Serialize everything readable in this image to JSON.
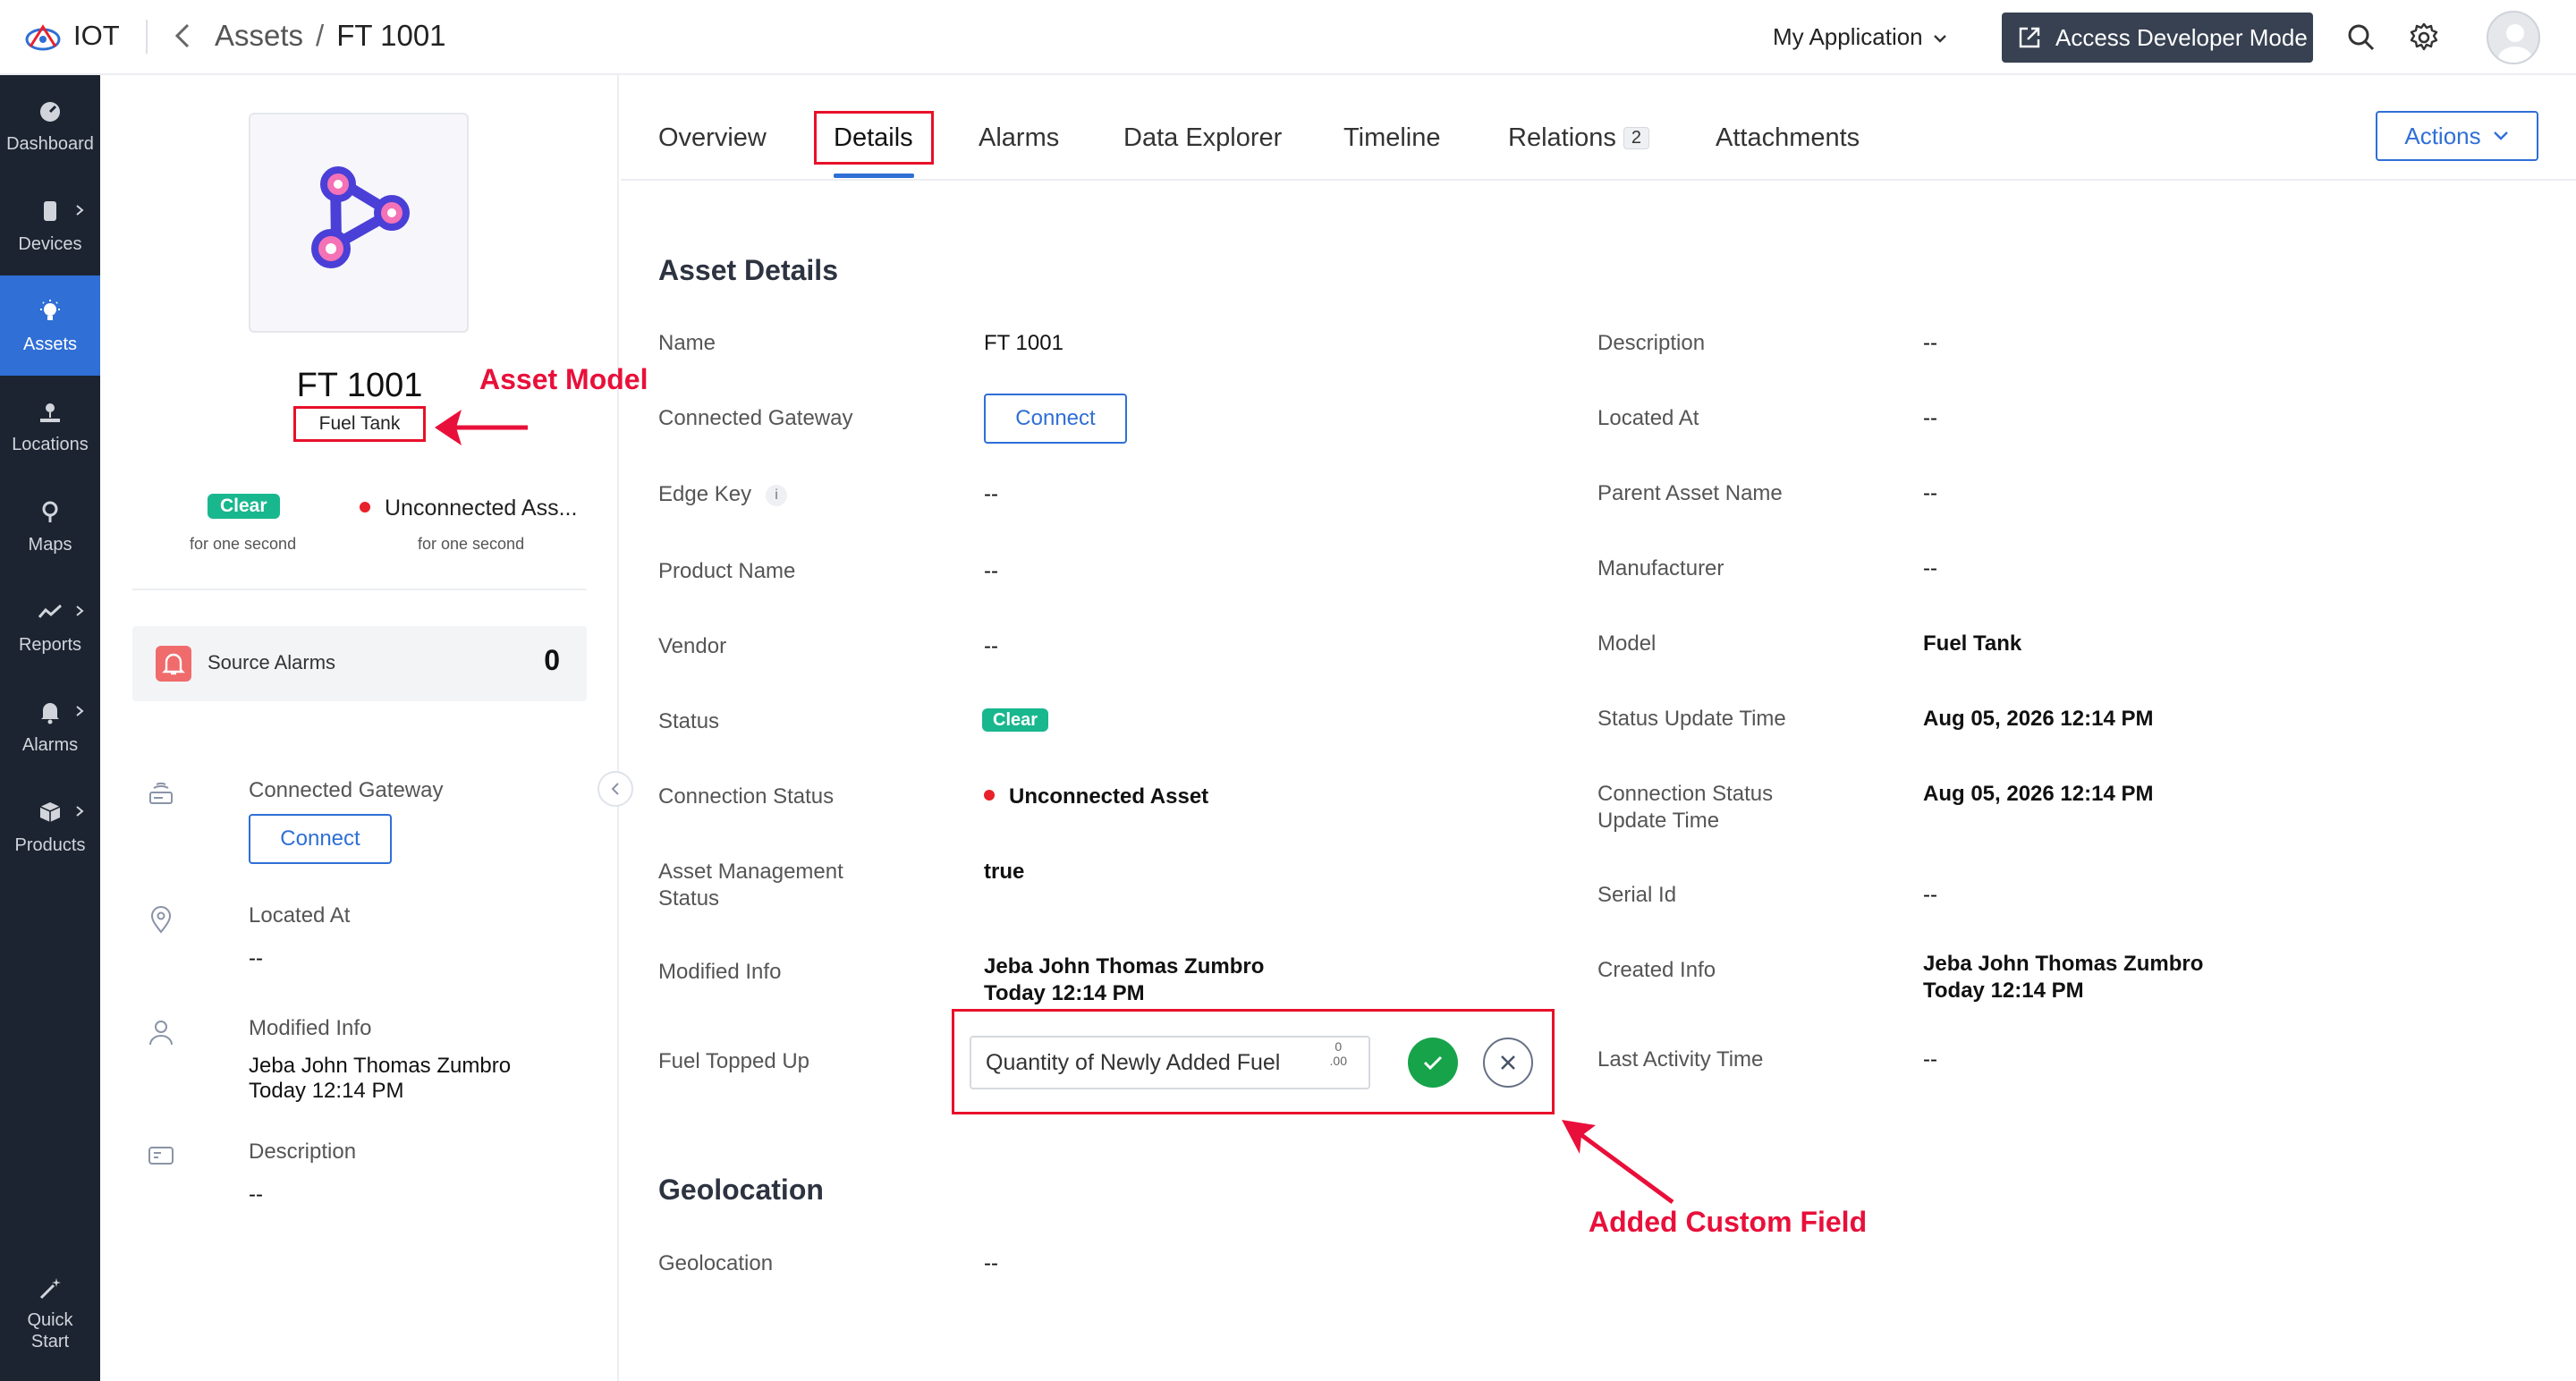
{
  "header": {
    "brand": "IOT",
    "breadcrumb": {
      "parent": "Assets",
      "separator": "/",
      "current": "FT 1001"
    },
    "app_selector": "My Application",
    "developer_button": "Access Developer Mode"
  },
  "sidebar": {
    "items": [
      {
        "label": "Dashboard",
        "icon": "dashboard-icon",
        "active": false
      },
      {
        "label": "Devices",
        "icon": "devices-icon",
        "active": false
      },
      {
        "label": "Assets",
        "icon": "assets-icon",
        "active": true
      },
      {
        "label": "Locations",
        "icon": "locations-icon",
        "active": false
      },
      {
        "label": "Maps",
        "icon": "maps-icon",
        "active": false
      },
      {
        "label": "Reports",
        "icon": "reports-icon",
        "active": false
      },
      {
        "label": "Alarms",
        "icon": "alarms-icon",
        "active": false
      },
      {
        "label": "Products",
        "icon": "products-icon",
        "active": false
      }
    ],
    "quick_start": {
      "line1": "Quick",
      "line2": "Start"
    }
  },
  "asset": {
    "name": "FT 1001",
    "model": "Fuel Tank",
    "status_badge": "Clear",
    "status_duration": "for one second",
    "connection_status": "Unconnected Ass...",
    "connection_duration": "for one second",
    "source_alarms_label": "Source Alarms",
    "source_alarms_count": "0",
    "connected_gateway_label": "Connected Gateway",
    "connect_button": "Connect",
    "located_at_label": "Located At",
    "located_at_value": "--",
    "modified_info_label": "Modified Info",
    "modified_by": "Jeba John Thomas Zumbro",
    "modified_time": "Today 12:14 PM",
    "description_label": "Description",
    "description_value": "--"
  },
  "tabs": [
    {
      "label": "Overview"
    },
    {
      "label": "Details"
    },
    {
      "label": "Alarms"
    },
    {
      "label": "Data Explorer"
    },
    {
      "label": "Timeline"
    },
    {
      "label": "Relations",
      "badge": "2"
    },
    {
      "label": "Attachments"
    }
  ],
  "actions_button": "Actions",
  "details": {
    "section_title": "Asset Details",
    "left": {
      "name": {
        "label": "Name",
        "value": "FT 1001"
      },
      "gateway": {
        "label": "Connected Gateway",
        "button": "Connect"
      },
      "edge_key": {
        "label": "Edge Key",
        "info": "i",
        "value": "--"
      },
      "product_name": {
        "label": "Product Name",
        "value": "--"
      },
      "vendor": {
        "label": "Vendor",
        "value": "--"
      },
      "status": {
        "label": "Status",
        "value": "Clear"
      },
      "connection_status": {
        "label": "Connection Status",
        "value": "Unconnected Asset"
      },
      "asset_mgmt": {
        "label_line1": "Asset Management",
        "label_line2": "Status",
        "value": "true"
      },
      "modified_info": {
        "label": "Modified Info",
        "value_line1": "Jeba John Thomas Zumbro",
        "value_line2": "Today 12:14 PM"
      },
      "fuel_topped_up": {
        "label": "Fuel Topped Up",
        "placeholder": "Quantity of Newly Added Fuel",
        "num_top": "0",
        "num_bottom": ".00"
      }
    },
    "right": {
      "description": {
        "label": "Description",
        "value": "--"
      },
      "located_at": {
        "label": "Located At",
        "value": "--"
      },
      "parent_asset": {
        "label": "Parent Asset Name",
        "value": "--"
      },
      "manufacturer": {
        "label": "Manufacturer",
        "value": "--"
      },
      "model": {
        "label": "Model",
        "value": "Fuel Tank"
      },
      "status_update_time": {
        "label": "Status Update Time",
        "value": "Aug 05, 2026 12:14 PM"
      },
      "conn_update_time": {
        "label_line1": "Connection Status",
        "label_line2": "Update Time",
        "value": "Aug 05, 2026 12:14 PM"
      },
      "serial_id": {
        "label": "Serial Id",
        "value": "--"
      },
      "created_info": {
        "label": "Created Info",
        "value_line1": "Jeba John Thomas Zumbro",
        "value_line2": "Today 12:14 PM"
      },
      "last_activity": {
        "label": "Last Activity Time",
        "value": "--"
      }
    },
    "geolocation_title": "Geolocation",
    "geolocation": {
      "label": "Geolocation",
      "value": "--"
    }
  },
  "annotations": {
    "asset_model": "Asset Model",
    "custom_field": "Added Custom Field"
  },
  "colors": {
    "sidebar_bg": "#1c2431",
    "active_blue": "#2f6fd6",
    "clear_green": "#19b78e",
    "annotation_red": "#e8103a",
    "confirm_green": "#17a34a"
  }
}
